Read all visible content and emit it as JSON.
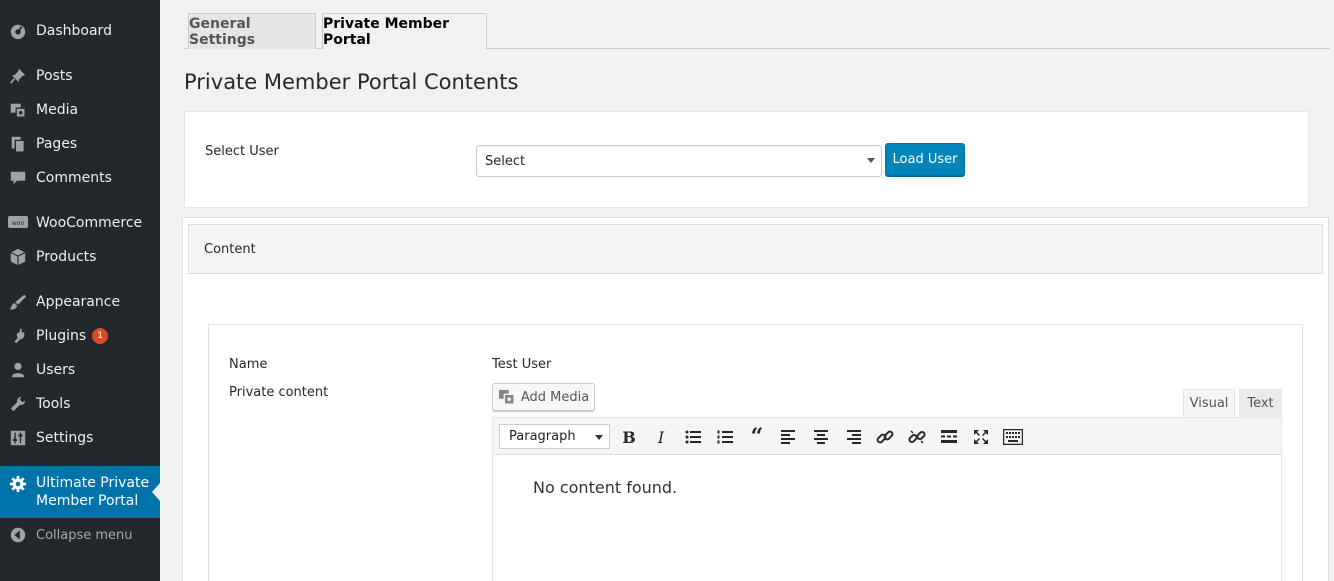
{
  "sidebar": {
    "items": [
      {
        "label": "Dashboard",
        "icon": "dashboard-icon"
      },
      {
        "label": "Posts",
        "icon": "pin-icon"
      },
      {
        "label": "Media",
        "icon": "media-icon"
      },
      {
        "label": "Pages",
        "icon": "pages-icon"
      },
      {
        "label": "Comments",
        "icon": "comment-icon"
      },
      {
        "label": "WooCommerce",
        "icon": "woo-icon"
      },
      {
        "label": "Products",
        "icon": "box-icon"
      },
      {
        "label": "Appearance",
        "icon": "brush-icon"
      },
      {
        "label": "Plugins",
        "icon": "plug-icon",
        "badge": "1"
      },
      {
        "label": "Users",
        "icon": "user-icon"
      },
      {
        "label": "Tools",
        "icon": "wrench-icon"
      },
      {
        "label": "Settings",
        "icon": "sliders-icon"
      }
    ],
    "active": {
      "line1": "Ultimate Private",
      "line2": "Member Portal",
      "icon": "gear-icon"
    },
    "collapse_label": "Collapse menu",
    "bg_color": "#23282d",
    "active_color": "#0073aa"
  },
  "tabs": [
    {
      "label": "General Settings",
      "active": false
    },
    {
      "label": "Private Member Portal",
      "active": true
    }
  ],
  "page_title": "Private Member Portal Contents",
  "select_user": {
    "label": "Select User",
    "value": "Select",
    "button_label": "Load User"
  },
  "content_section": {
    "header": "Content",
    "name_label": "Name",
    "name_value": "Test User",
    "private_label": "Private content",
    "add_media_label": "Add Media",
    "editor_tabs": {
      "visual": "Visual",
      "text": "Text"
    },
    "format_value": "Paragraph",
    "toolbar": [
      "bold-icon",
      "italic-icon",
      "bullet-list-icon",
      "numbered-list-icon",
      "blockquote-icon",
      "align-left-icon",
      "align-center-icon",
      "align-right-icon",
      "link-icon",
      "unlink-icon",
      "read-more-icon",
      "fullscreen-icon",
      "keyboard-icon"
    ],
    "body_text": "No content found."
  }
}
